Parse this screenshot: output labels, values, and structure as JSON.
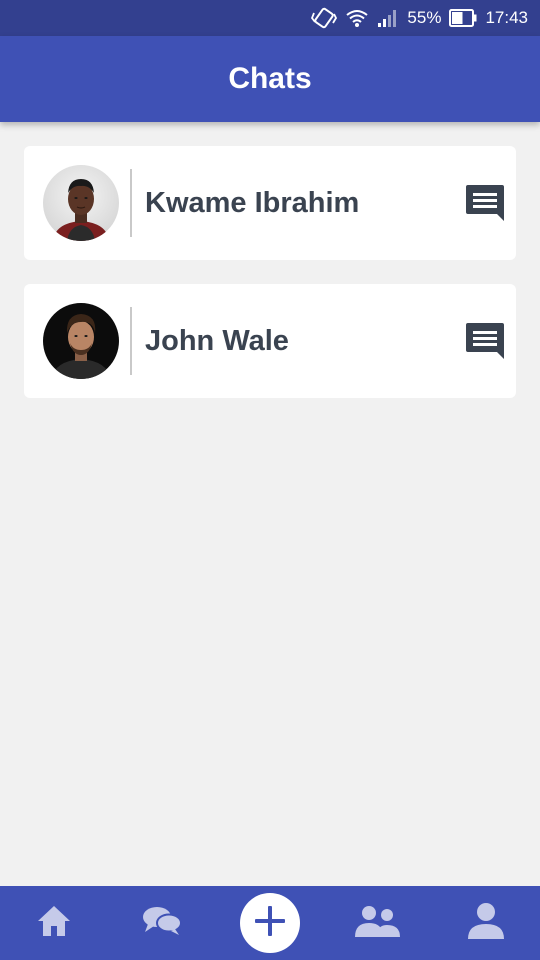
{
  "status_bar": {
    "battery_percent": "55%",
    "battery_level": 0.55,
    "time": "17:43",
    "icons": [
      "vibrate-icon",
      "wifi-icon",
      "signal-icon",
      "battery-icon"
    ]
  },
  "app_bar": {
    "title": "Chats"
  },
  "chats": [
    {
      "name": "Kwame Ibrahim",
      "avatar": "avatar-kwame",
      "action_icon": "message-icon"
    },
    {
      "name": "John Wale",
      "avatar": "avatar-john",
      "action_icon": "message-icon"
    }
  ],
  "bottom_nav": {
    "items": [
      "home-icon",
      "chats-icon",
      "add-icon",
      "contacts-icon",
      "profile-icon"
    ]
  },
  "colors": {
    "primary": "#3f51b5",
    "status_bar": "#33408f",
    "background": "#f1f1f1",
    "card": "#ffffff",
    "name_text": "#3a4350",
    "nav_icon_inactive": "#c5cae9"
  }
}
